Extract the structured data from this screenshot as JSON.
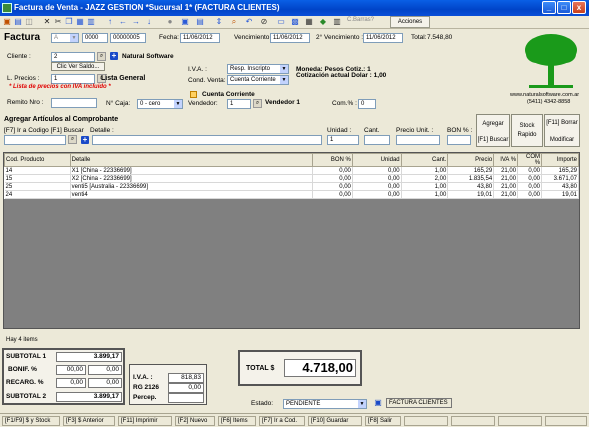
{
  "window": {
    "title": "Factura de Venta - JAZZ GESTION *Sucursal 1* (FACTURA CLIENTES)",
    "min": "_",
    "max": "□",
    "close": "x"
  },
  "toolbar": {
    "cbarras": "C.Barras?",
    "acciones": "Acciones"
  },
  "header": {
    "doc_type": "Factura",
    "letter": "A",
    "num1": "0000",
    "num2": "00000005",
    "fecha_label": "Fecha:",
    "fecha": "11/06/2012",
    "venc_label": "Vencimiento :",
    "venc": "11/06/2012",
    "venc2_label": "2° Vencimiento :",
    "venc2": "11/06/2012",
    "total_label": "Total:",
    "total": "7.548,80"
  },
  "client": {
    "label": "Cliente :",
    "code": "2",
    "name": "Natural Software",
    "clic_btn": "Clic Ver Saldo...",
    "iva_label": "I.V.A. :",
    "iva_value": "Resp. Inscripto",
    "cond_label": "Cond. Venta:",
    "cond_value": "Cuenta Corriente",
    "moneda": "Moneda: Pesos Cotiz.: 1",
    "cotiz": "Cotización actual Dolar : 1,00",
    "precios_label": "L. Precios :",
    "precios_code": "1",
    "precios_name": "Lista General",
    "iva_note": "* Lista de precios con IVA incluido *",
    "cc_check": "Cuenta Corriente",
    "remito_label": "Remito Nro :",
    "caja_label": "N° Caja:",
    "caja_value": "0 - cero",
    "vendedor_label": "Vendedor:",
    "vendedor_code": "1",
    "vendedor_name": "Vendedor 1",
    "com_label": "Com.% :",
    "com_value": "0"
  },
  "logo": {
    "url": "www.naturalsoftware.com.ar",
    "phone": "(5411) 4342-8858"
  },
  "add": {
    "title": "Agregar Artículos al Comprobante",
    "code_label": "[F7] Ir a Codigo [F1] Buscar",
    "detalle_label": "Detalle :",
    "unidad_label": "Unidad :",
    "unidad_value": "1",
    "cant_label": "Cant.",
    "precio_label": "Precio Unit. :",
    "bon_label": "BON % :",
    "agregar": "Agregar",
    "buscar": "[F1] Buscar",
    "stock": "Stock",
    "rapido": "Rapido",
    "borrar": "[F11] Borrar",
    "modificar": "Modificar"
  },
  "grid": {
    "columns": [
      "Cod. Producto",
      "Detalle",
      "BON %",
      "Unidad",
      "Cant.",
      "Precio",
      "IVA %",
      "COM %",
      "Importe"
    ],
    "rows": [
      [
        "14",
        "X1 [China - 22336699]",
        "0,00",
        "0,00",
        "1,00",
        "165,29",
        "21,00",
        "0,00",
        "165,29"
      ],
      [
        "15",
        "X2 [China - 22336699]",
        "0,00",
        "0,00",
        "2,00",
        "1.835,54",
        "21,00",
        "0,00",
        "3.671,07"
      ],
      [
        "25",
        "venti5 [Australia - 22336699]",
        "0,00",
        "0,00",
        "1,00",
        "43,80",
        "21,00",
        "0,00",
        "43,80"
      ],
      [
        "24",
        "venti4",
        "0,00",
        "0,00",
        "1,00",
        "19,01",
        "21,00",
        "0,00",
        "19,01"
      ]
    ],
    "items_count": "Hay 4 items"
  },
  "totals": {
    "sub1_label": "SUBTOTAL 1",
    "sub1": "3.899,17",
    "bonif_label": "BONIF. %",
    "bonif_pct": "00,00",
    "bonif": "0,00",
    "recarg_label": "RECARG. %",
    "recarg_pct": "0,00",
    "recarg": "0,00",
    "sub2_label": "SUBTOTAL 2",
    "sub2": "3.899,17",
    "iva_label": "I.V.A. :",
    "iva": "818,83",
    "rg_label": "RG 2126",
    "rg": "0,00",
    "percep_label": "Percep.",
    "percep": "",
    "total_label": "TOTAL $",
    "total": "4.718,00"
  },
  "estado": {
    "label": "Estado:",
    "value": "PENDIENTE",
    "doc_label": "FACTURA CLIENTES"
  },
  "status": [
    "[F1/F9] $ y Stock",
    "[F3] $ Anterior",
    "[F11] Imprimir",
    "[F2] Nuevo",
    "[F6] Items",
    "[F7] Ir a Cod.",
    "[F10] Guardar",
    "[F8] Salir"
  ]
}
